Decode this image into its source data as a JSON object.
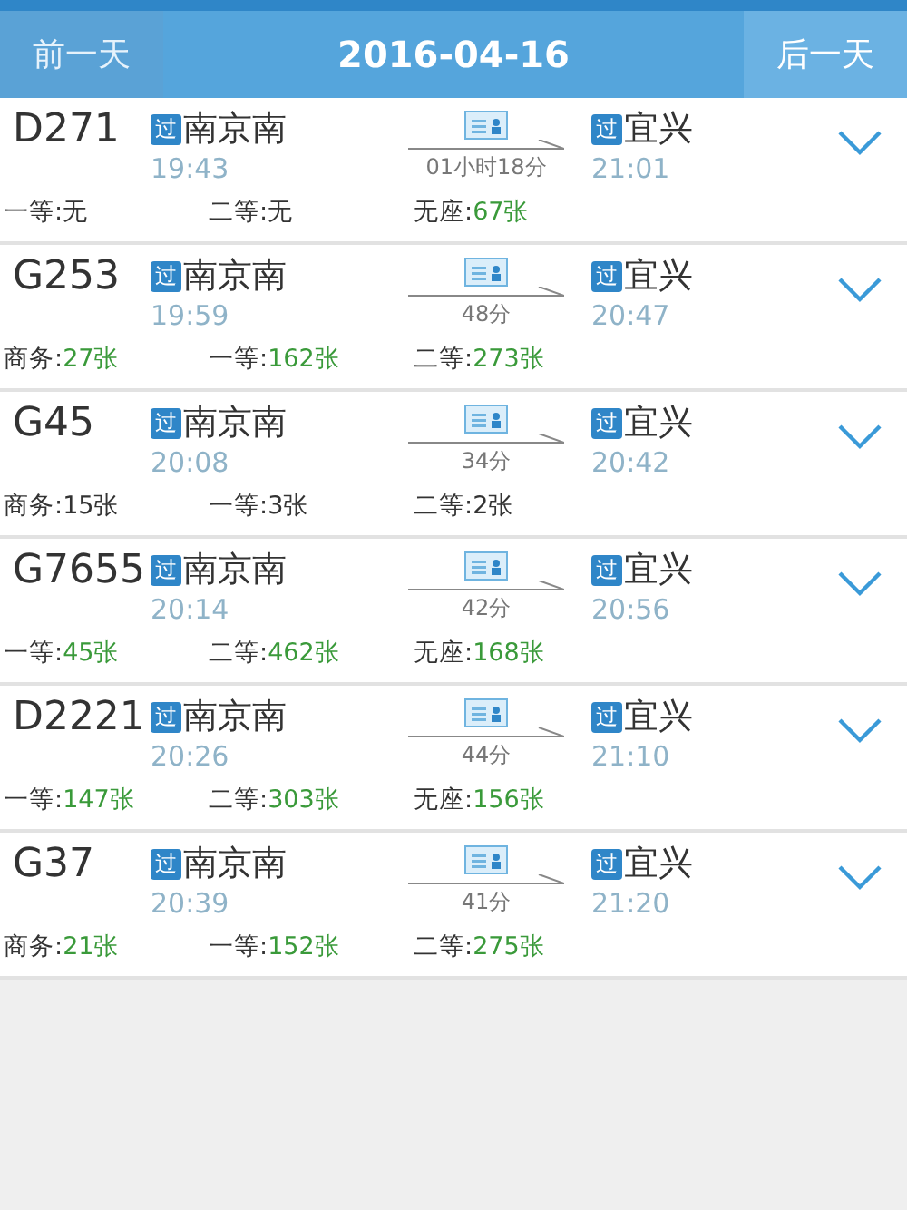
{
  "nav": {
    "prev": {
      "label": "前一天",
      "disabled": true
    },
    "date": "2016-04-16",
    "next": {
      "label": "后一天",
      "disabled": false
    }
  },
  "trains": [
    {
      "number": "D271",
      "from": {
        "badge": "过",
        "station": "南京南",
        "time": "19:43"
      },
      "duration": "01小时18分",
      "to": {
        "badge": "过",
        "station": "宜兴",
        "time": "21:01"
      },
      "seats": [
        {
          "label": "一等:",
          "value": "无",
          "available": false
        },
        {
          "label": "二等:",
          "value": "无",
          "available": false
        },
        {
          "label": "无座:",
          "value": "67张",
          "available": true
        }
      ]
    },
    {
      "number": "G253",
      "from": {
        "badge": "过",
        "station": "南京南",
        "time": "19:59"
      },
      "duration": "48分",
      "to": {
        "badge": "过",
        "station": "宜兴",
        "time": "20:47"
      },
      "seats": [
        {
          "label": "商务:",
          "value": "27张",
          "available": true
        },
        {
          "label": "一等:",
          "value": "162张",
          "available": true
        },
        {
          "label": "二等:",
          "value": "273张",
          "available": true
        }
      ]
    },
    {
      "number": "G45",
      "from": {
        "badge": "过",
        "station": "南京南",
        "time": "20:08"
      },
      "duration": "34分",
      "to": {
        "badge": "过",
        "station": "宜兴",
        "time": "20:42"
      },
      "seats": [
        {
          "label": "商务:",
          "value": "15张",
          "available": false
        },
        {
          "label": "一等:",
          "value": "3张",
          "available": false
        },
        {
          "label": "二等:",
          "value": "2张",
          "available": false
        }
      ]
    },
    {
      "number": "G7655",
      "from": {
        "badge": "过",
        "station": "南京南",
        "time": "20:14"
      },
      "duration": "42分",
      "to": {
        "badge": "过",
        "station": "宜兴",
        "time": "20:56"
      },
      "seats": [
        {
          "label": "一等:",
          "value": "45张",
          "available": true
        },
        {
          "label": "二等:",
          "value": "462张",
          "available": true
        },
        {
          "label": "无座:",
          "value": "168张",
          "available": true
        }
      ]
    },
    {
      "number": "D2221",
      "from": {
        "badge": "过",
        "station": "南京南",
        "time": "20:26"
      },
      "duration": "44分",
      "to": {
        "badge": "过",
        "station": "宜兴",
        "time": "21:10"
      },
      "seats": [
        {
          "label": "一等:",
          "value": "147张",
          "available": true
        },
        {
          "label": "二等:",
          "value": "303张",
          "available": true
        },
        {
          "label": "无座:",
          "value": "156张",
          "available": true
        }
      ]
    },
    {
      "number": "G37",
      "from": {
        "badge": "过",
        "station": "南京南",
        "time": "20:39"
      },
      "duration": "41分",
      "to": {
        "badge": "过",
        "station": "宜兴",
        "time": "21:20"
      },
      "seats": [
        {
          "label": "商务:",
          "value": "21张",
          "available": true
        },
        {
          "label": "一等:",
          "value": "152张",
          "available": true
        },
        {
          "label": "二等:",
          "value": "275张",
          "available": true
        }
      ]
    }
  ]
}
